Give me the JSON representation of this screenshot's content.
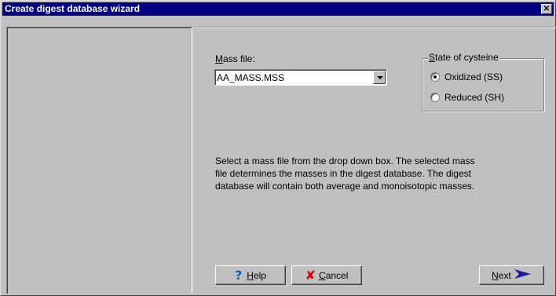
{
  "window": {
    "title": "Create digest database wizard",
    "close_label": "✕"
  },
  "mass_file": {
    "label_prefix": "",
    "label_accel": "M",
    "label_rest": "ass file:",
    "value": "AA_MASS.MSS"
  },
  "cysteine": {
    "title_accel": "S",
    "title_rest": "tate of cysteine",
    "options": [
      {
        "label": "Oxidized (SS)",
        "selected": true
      },
      {
        "label": "Reduced (SH)",
        "selected": false
      }
    ]
  },
  "description": [
    "Select a mass file from the drop down box. The selected mass",
    "file determines the masses in the digest database. The digest",
    "database will contain both average and monoisotopic masses."
  ],
  "buttons": {
    "help": {
      "accel": "H",
      "rest": "elp",
      "icon": "help-icon"
    },
    "cancel": {
      "accel": "C",
      "rest": "ancel",
      "icon": "cancel-icon"
    },
    "next": {
      "accel": "N",
      "rest": "ext",
      "icon": "arrow-right-icon"
    }
  },
  "colors": {
    "titlebar": "#000080",
    "face": "#c0c0c0",
    "help_icon": "#1060c0",
    "cancel_icon": "#e00000",
    "next_icon": "#1a1aa0"
  }
}
